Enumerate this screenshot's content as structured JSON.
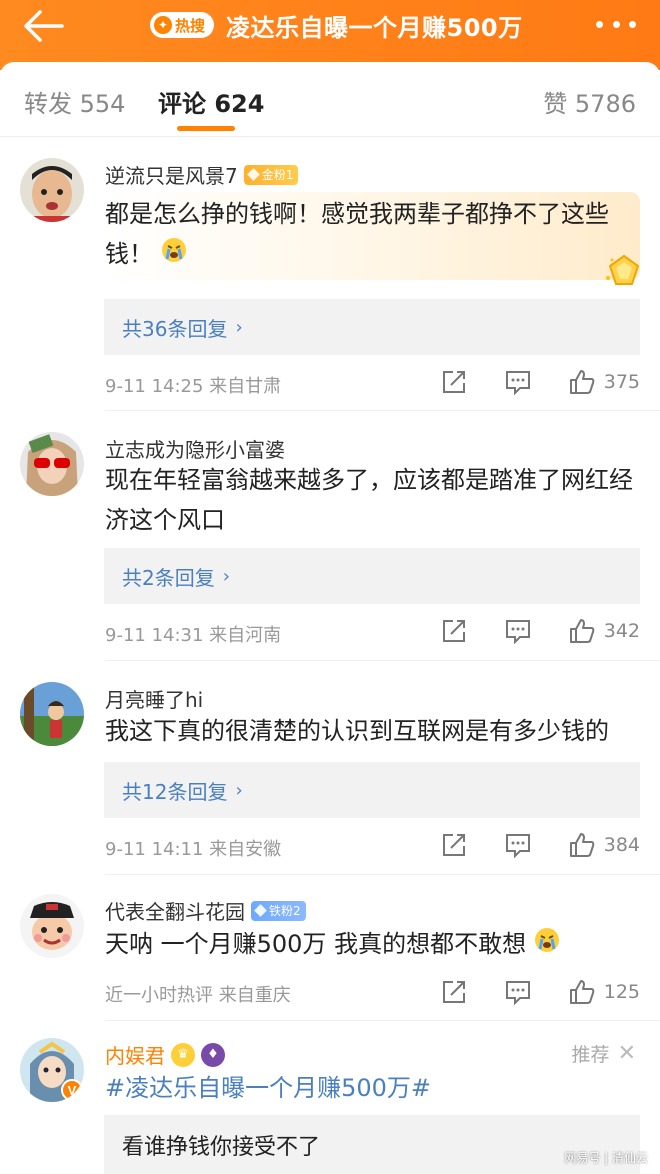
{
  "header": {
    "hot_badge": "热搜",
    "title": "凌达乐自曝一个月赚500万"
  },
  "tabs": {
    "repost": "转发 554",
    "comment": "评论 624",
    "like": "赞 5786"
  },
  "comments": [
    {
      "username": "逆流只是风景7",
      "fan_badge": "金粉1",
      "text": "都是怎么挣的钱啊！感觉我两辈子都挣不了这些钱！",
      "replies": "共36条回复",
      "meta": "9-11 14:25  来自甘肃",
      "likes": "375"
    },
    {
      "username": "立志成为隐形小富婆",
      "text": "现在年轻富翁越来越多了，应该都是踏准了网红经济这个风口",
      "replies": "共2条回复",
      "meta": "9-11 14:31  来自河南",
      "likes": "342"
    },
    {
      "username": "月亮睡了hi",
      "text": "我这下真的很清楚的认识到互联网是有多少钱的",
      "replies": "共12条回复",
      "meta": "9-11 14:11  来自安徽",
      "likes": "384"
    },
    {
      "username": "代表全翻斗花园",
      "fan_badge": "铁粉2",
      "text": "天呐 一个月赚500万 我真的想都不敢想",
      "meta": "近一小时热评  来自重庆",
      "likes": "125"
    },
    {
      "username": "内娱君",
      "recommend": "推荐",
      "topic": "#凌达乐自曝一个月赚500万#",
      "reply_preview": "看谁挣钱你接受不了"
    }
  ],
  "watermark": "网易号 | 清仙云",
  "colors": {
    "brand_orange": "#ff8200",
    "link_blue": "#4a7fc0",
    "reply_bg": "#f2f2f2"
  }
}
